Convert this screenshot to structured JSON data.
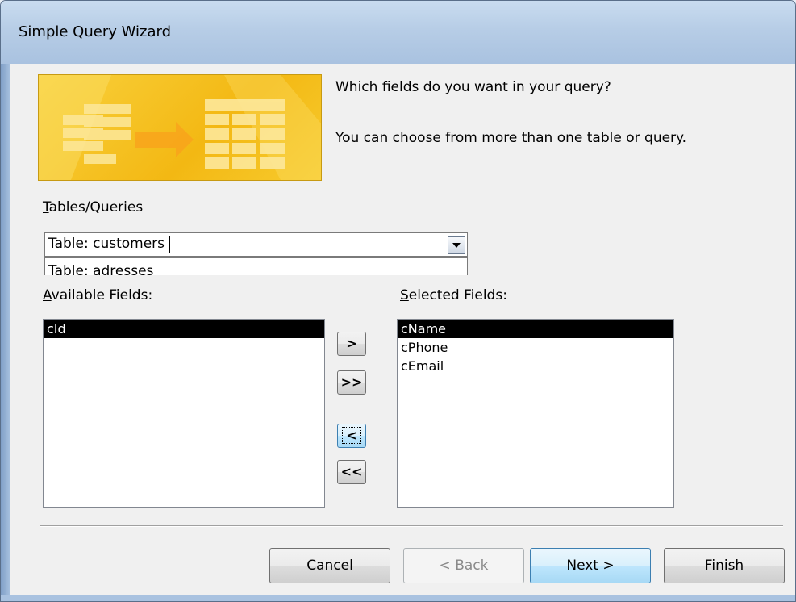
{
  "window": {
    "title": "Simple Query Wizard"
  },
  "intro": {
    "question": "Which fields do you want in your query?",
    "hint": "You can choose from more than one table or query."
  },
  "tables_queries": {
    "label_first": "T",
    "label_rest": "ables/Queries",
    "selected": "Table: customers",
    "dropdown_item": "Table: adresses"
  },
  "available_fields": {
    "label_first": "A",
    "label_rest": "vailable Fields:",
    "items": [
      "cId"
    ],
    "selected_index": 0
  },
  "selected_fields": {
    "label_first": "S",
    "label_rest": "elected Fields:",
    "items": [
      "cName",
      "cPhone",
      "cEmail"
    ],
    "selected_index": 0
  },
  "move_buttons": {
    "add_one": ">",
    "add_all": ">>",
    "remove_one": "<",
    "remove_all": "<<"
  },
  "footer": {
    "cancel": "Cancel",
    "back_prefix": "< ",
    "back_accel": "B",
    "back_rest": "ack",
    "next_accel": "N",
    "next_rest": "ext >",
    "finish_accel": "F",
    "finish_rest": "inish"
  },
  "colors": {
    "banner": "#f3b813",
    "selection": "#000000",
    "default_button": "#bee6fd"
  }
}
